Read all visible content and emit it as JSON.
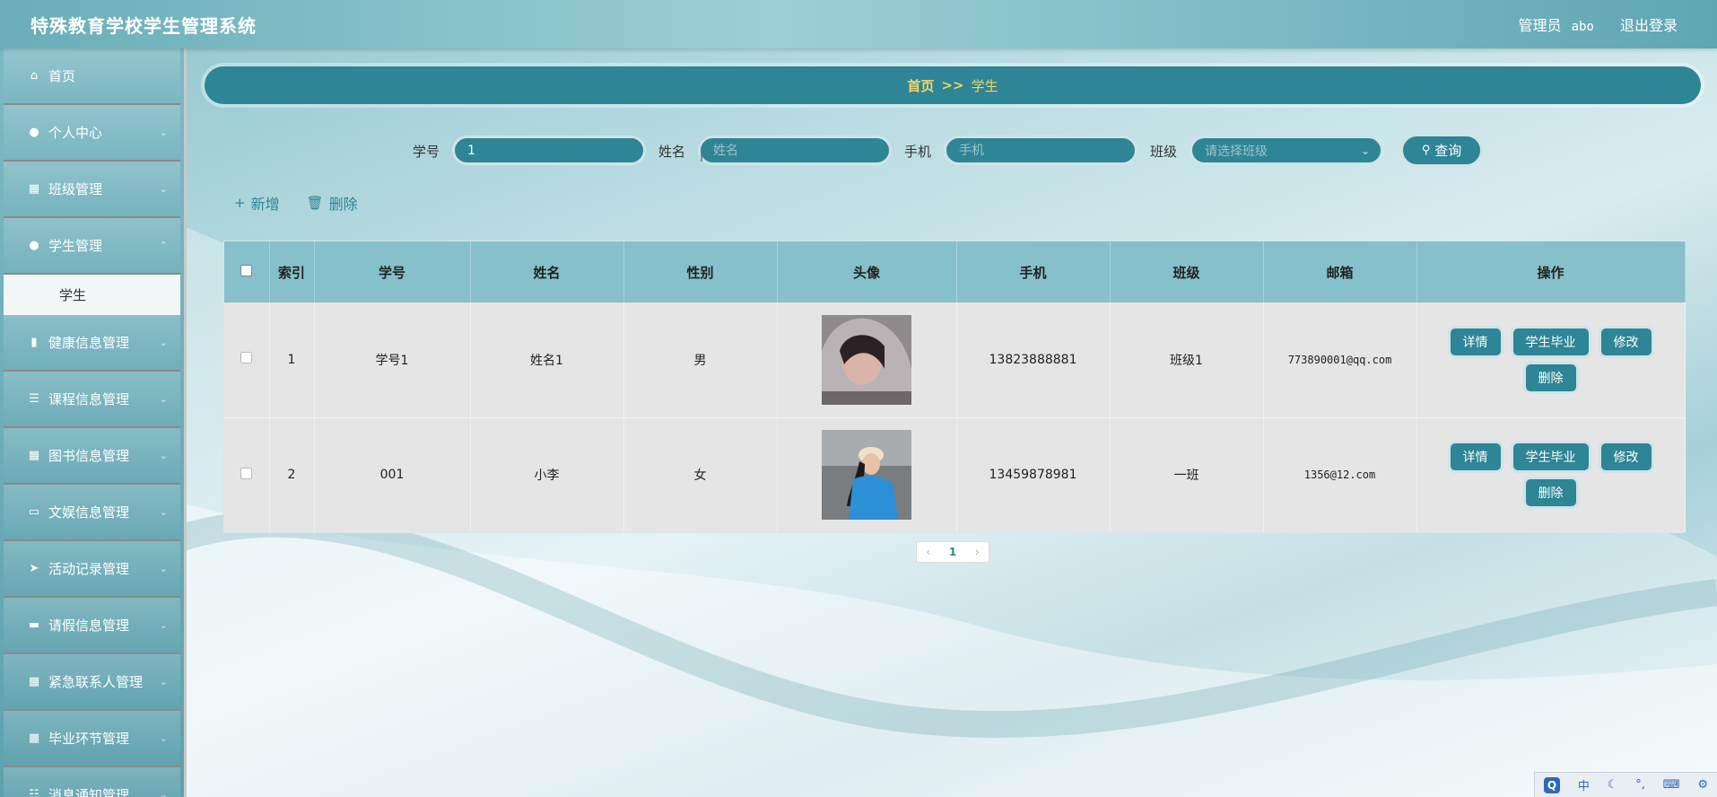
{
  "app": {
    "title": "特殊教育学校学生管理系统"
  },
  "user": {
    "role": "管理员",
    "name": "abo",
    "logout": "退出登录"
  },
  "sidebar": {
    "items": [
      {
        "label": "首页",
        "icon": "home-icon"
      },
      {
        "label": "个人中心",
        "icon": "user-icon"
      },
      {
        "label": "班级管理",
        "icon": "grid-icon"
      },
      {
        "label": "学生管理",
        "icon": "user-icon"
      },
      {
        "label": "健康信息管理",
        "icon": "bar-chart-icon"
      },
      {
        "label": "课程信息管理",
        "icon": "list-icon"
      },
      {
        "label": "图书信息管理",
        "icon": "grid-icon"
      },
      {
        "label": "文娱信息管理",
        "icon": "monitor-icon"
      },
      {
        "label": "活动记录管理",
        "icon": "send-icon"
      },
      {
        "label": "请假信息管理",
        "icon": "ticket-icon"
      },
      {
        "label": "紧急联系人管理",
        "icon": "grid-icon"
      },
      {
        "label": "毕业环节管理",
        "icon": "grid-icon"
      },
      {
        "label": "消息通知管理",
        "icon": "sliders-icon"
      }
    ],
    "active_sub": "学生"
  },
  "breadcrumb": {
    "home": "首页",
    "separator": ">>",
    "current": "学生"
  },
  "search": {
    "id_label": "学号",
    "id_value": "1",
    "name_label": "姓名",
    "name_placeholder": "姓名",
    "phone_label": "手机",
    "phone_placeholder": "手机",
    "class_label": "班级",
    "class_placeholder": "请选择班级",
    "button": "查询"
  },
  "actions": {
    "add": "新增",
    "delete": "删除"
  },
  "table": {
    "headers": [
      "索引",
      "学号",
      "姓名",
      "性别",
      "头像",
      "手机",
      "班级",
      "邮箱",
      "操作"
    ],
    "rows": [
      {
        "index": "1",
        "id": "学号1",
        "name": "姓名1",
        "gender": "男",
        "phone": "13823888881",
        "class": "班级1",
        "email": "773890001@qq.com"
      },
      {
        "index": "2",
        "id": "001",
        "name": "小李",
        "gender": "女",
        "phone": "13459878981",
        "class": "一班",
        "email": "1356@12.com"
      }
    ],
    "op_buttons": {
      "detail": "详情",
      "graduate": "学生毕业",
      "edit": "修改",
      "delete": "删除"
    }
  },
  "pagination": {
    "current_page": "1"
  },
  "tray": {
    "ime": "中"
  },
  "colors": {
    "primary": "#2e8595",
    "breadcrumb_text": "#f5d36a",
    "header_row": "#86c0cb"
  }
}
